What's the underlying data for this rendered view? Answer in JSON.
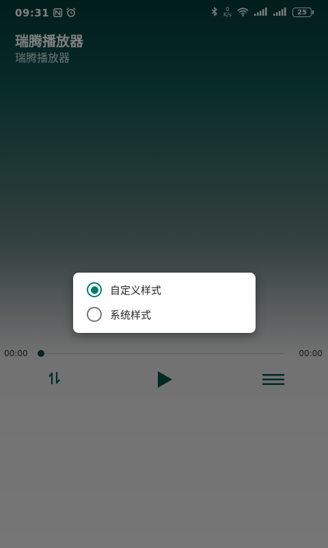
{
  "status_bar": {
    "time": "09:31",
    "nfc_icon": "N",
    "alarm_icon": "alarm-icon",
    "bluetooth_icon": "bluetooth-icon",
    "net_speed_value": "0",
    "net_speed_unit": "K/s",
    "battery": "25"
  },
  "app": {
    "title": "瑞腾播放器",
    "subtitle": "瑞腾播放器"
  },
  "player": {
    "current_time": "00:00",
    "total_time": "00:00",
    "progress": 0.0
  },
  "dialog": {
    "options": [
      {
        "label": "自定义样式",
        "checked": true
      },
      {
        "label": "系统样式",
        "checked": false
      }
    ]
  },
  "colors": {
    "accent": "#00796b",
    "header_dark": "#003b37"
  }
}
